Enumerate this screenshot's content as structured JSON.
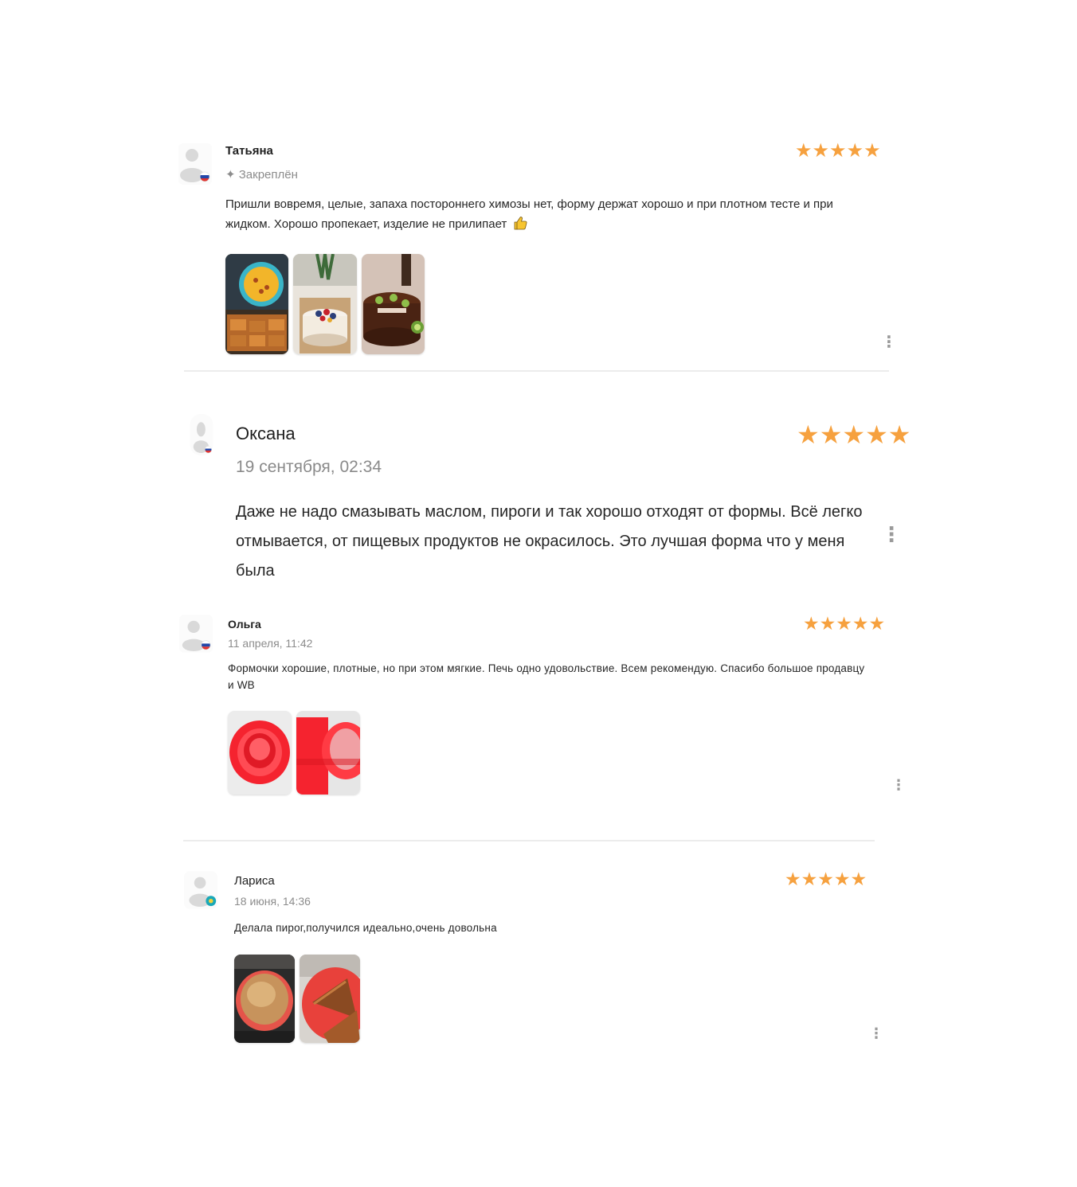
{
  "colors": {
    "star": "#f6a13f",
    "divider": "#ececec",
    "flag_ru": [
      "#ffffff",
      "#2347a8",
      "#e0332f"
    ],
    "flag_kz": "#1aa8b8"
  },
  "reviews": [
    {
      "author": "Татьяна",
      "meta": "Закреплён",
      "meta_icon": "pin-icon",
      "rating": 5,
      "text": "Пришли вовремя, целые, запаха постороннего химозы нет, форму держат хорошо и при плотном тесте и при жидком. Хорошо пропекает, изделие не прилипает",
      "text_icon": "thumbs-up-icon",
      "flag": "ru",
      "photos": [
        "пирог и выпечка в форме",
        "торт с ягодами",
        "шоколадный торт с киви"
      ]
    },
    {
      "author": "Оксана",
      "meta": "19 сентября, 02:34",
      "rating": 5,
      "text": "Даже не надо смазывать маслом, пироги и так хорошо отходят от формы. Всё легко отмывается, от пищевых продуктов не окрасилось. Это лучшая форма что у меня была",
      "flag": "ru",
      "photos": []
    },
    {
      "author": "Ольга",
      "meta": "11 апреля, 11:42",
      "rating": 5,
      "text": "Формочки хорошие, плотные, но при этом мягкие. Печь одно удовольствие. Всем рекомендую. Спасибо большое продавцу и WB",
      "flag": "ru",
      "photos": [
        "красные силиконовые формы",
        "красная форма"
      ]
    },
    {
      "author": "Лариса",
      "meta": "18 июня, 14:36",
      "rating": 5,
      "text": "Делала пирог,получился идеально,очень довольна",
      "flag": "kz",
      "photos": [
        "пирог в красной форме",
        "нарезанный пирог"
      ]
    }
  ]
}
